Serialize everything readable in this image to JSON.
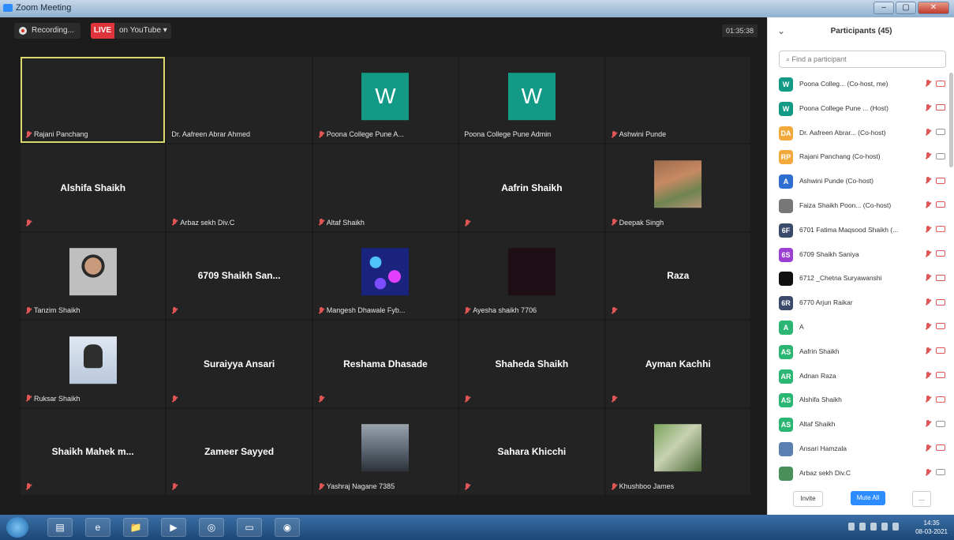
{
  "window": {
    "title": "Zoom Meeting",
    "controls": [
      "–",
      "▢",
      "✕"
    ]
  },
  "topbar": {
    "recording_label": "Recording...",
    "live_badge": "LIVE",
    "live_target": "on YouTube ▾",
    "timer": "01:35:38"
  },
  "tiles": [
    {
      "label": "Rajani Panchang",
      "muted": true,
      "active": true
    },
    {
      "label": "Dr. Aafreen Abrar Ahmed",
      "muted": false
    },
    {
      "label": "Poona College Pune A...",
      "muted": true,
      "avatar_letter": "W"
    },
    {
      "label": "Poona College Pune Admin",
      "muted": false,
      "avatar_letter": "W"
    },
    {
      "label": "Ashwini Punde",
      "muted": true
    },
    {
      "center_name": "Alshifa Shaikh",
      "label": "",
      "muted": true
    },
    {
      "label": "Arbaz sekh Div.C",
      "muted": true
    },
    {
      "label": "Altaf Shaikh",
      "muted": true
    },
    {
      "center_name": "Aafrin Shaikh",
      "label": "",
      "muted": true
    },
    {
      "label": "Deepak Singh",
      "muted": true,
      "photo": "deepak"
    },
    {
      "label": "Tanzim Shaikh",
      "muted": true,
      "photo": "tanzim"
    },
    {
      "center_name": "6709 Shaikh San...",
      "label": "",
      "muted": true
    },
    {
      "label": "Mangesh Dhawale Fyb...",
      "muted": true,
      "photo": "mangesh"
    },
    {
      "label": "Ayesha shaikh 7706",
      "muted": true,
      "photo": "ayesha"
    },
    {
      "center_name": "Raza",
      "label": "",
      "muted": true
    },
    {
      "label": "Ruksar Shaikh",
      "muted": true,
      "photo": "ruksar"
    },
    {
      "center_name": "Suraiyya Ansari",
      "label": "",
      "muted": true
    },
    {
      "center_name": "Reshama Dhasade",
      "label": "",
      "muted": true
    },
    {
      "center_name": "Shaheda Shaikh",
      "label": "",
      "muted": true
    },
    {
      "center_name": "Ayman Kachhi",
      "label": "",
      "muted": true
    },
    {
      "center_name": "Shaikh Mahek m...",
      "label": "",
      "muted": true
    },
    {
      "center_name": "Zameer Sayyed",
      "label": "",
      "muted": true
    },
    {
      "label": "Yashraj Nagane 7385",
      "muted": true,
      "photo": "yashraj"
    },
    {
      "center_name": "Sahara Khicchi",
      "label": "",
      "muted": true
    },
    {
      "label": "Khushboo James",
      "muted": true,
      "photo": "khushboo"
    }
  ],
  "panel": {
    "collapse_icon": "⌄",
    "title": "Participants (45)",
    "search_placeholder": "Find a participant",
    "participants": [
      {
        "initials": "W",
        "color": "#139a86",
        "name": "Poona Colleg... (Co-host, me)",
        "cam_off": false
      },
      {
        "initials": "W",
        "color": "#139a86",
        "name": "Poona College Pune ... (Host)",
        "cam_off": false
      },
      {
        "initials": "DA",
        "color": "#f2a93b",
        "name": "Dr. Aafreen Abrar... (Co-host)",
        "cam_off": true
      },
      {
        "initials": "RP",
        "color": "#f2a93b",
        "name": "Rajani Panchang (Co-host)",
        "cam_off": true
      },
      {
        "initials": "A",
        "color": "#2f6fd1",
        "name": "Ashwini Punde (Co-host)",
        "cam_off": false
      },
      {
        "initials": "",
        "color": "#777777",
        "name": "Faiza Shaikh Poon... (Co-host)",
        "cam_off": false
      },
      {
        "initials": "6F",
        "color": "#3a4a6b",
        "name": "6701 Fatima Maqsood Shaikh (...",
        "cam_off": false
      },
      {
        "initials": "6S",
        "color": "#9b3fd1",
        "name": "6709 Shaikh Saniya",
        "cam_off": false
      },
      {
        "initials": "",
        "color": "#111111",
        "name": "6712 _Chetna Suryawanshi",
        "cam_off": false
      },
      {
        "initials": "6R",
        "color": "#3a4a6b",
        "name": "6770 Arjun Raikar",
        "cam_off": false
      },
      {
        "initials": "A",
        "color": "#2bb673",
        "name": "A",
        "cam_off": false
      },
      {
        "initials": "AS",
        "color": "#2bb673",
        "name": "Aafrin Shaikh",
        "cam_off": false
      },
      {
        "initials": "AR",
        "color": "#2bb673",
        "name": "Adnan Raza",
        "cam_off": false
      },
      {
        "initials": "AS",
        "color": "#2bb673",
        "name": "Alshifa Shaikh",
        "cam_off": false
      },
      {
        "initials": "AS",
        "color": "#2bb673",
        "name": "Altaf Shaikh",
        "cam_off": true
      },
      {
        "initials": "",
        "color": "#5b7fb0",
        "name": "Ansari Hamzala",
        "cam_off": false
      },
      {
        "initials": "",
        "color": "#4a8f5a",
        "name": "Arbaz sekh Div.C",
        "cam_off": true
      }
    ],
    "footer": {
      "invite": "Invite",
      "mute_all": "Mute All",
      "more": "..."
    }
  },
  "taskbar": {
    "apps": [
      "▤",
      "e",
      "📁",
      "▶",
      "◎",
      "▭",
      "◉"
    ],
    "clock_time": "14:35",
    "clock_date": "08-03-2021"
  }
}
